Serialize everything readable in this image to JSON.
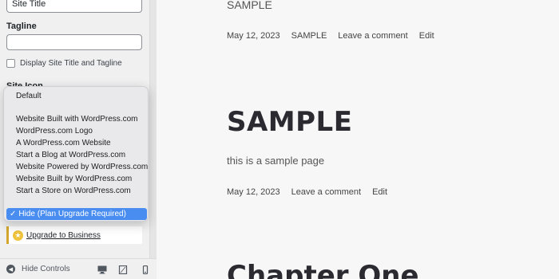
{
  "sidebar": {
    "site_title_value": "Site Title",
    "tagline_label": "Tagline",
    "tagline_value": "",
    "display_checkbox_label": "Display Site Title and Tagline",
    "site_icon_label": "Site Icon",
    "dropdown": {
      "options": [
        "Default",
        "Website Built with WordPress.com",
        "WordPress.com Logo",
        "A WordPress.com Website",
        "Start a Blog at WordPress.com",
        "Website Powered by WordPress.com",
        "Website Built by WordPress.com",
        "Start a Store on WordPress.com"
      ],
      "selected": "Hide (Plan Upgrade Required)",
      "selected_checkmark": "✓"
    },
    "upgrade_link": "Upgrade to Business",
    "footer": {
      "hide_controls": "Hide Controls"
    }
  },
  "main": {
    "top_title": "SAMPLE",
    "meta1": {
      "date": "May 12, 2023",
      "category": "SAMPLE",
      "comment": "Leave a comment",
      "edit": "Edit"
    },
    "heading": "SAMPLE",
    "body": "this is a sample page",
    "meta2": {
      "date": "May 12, 2023",
      "comment": "Leave a comment",
      "edit": "Edit"
    },
    "next_heading": "Chapter One"
  },
  "colors": {
    "selection": "#4a8df0",
    "upgrade_accent": "#d4a72c",
    "heading": "#2a2a30"
  },
  "icons": [
    "star-icon",
    "hide-controls-icon",
    "desktop-icon",
    "tablet-icon",
    "mobile-icon"
  ]
}
